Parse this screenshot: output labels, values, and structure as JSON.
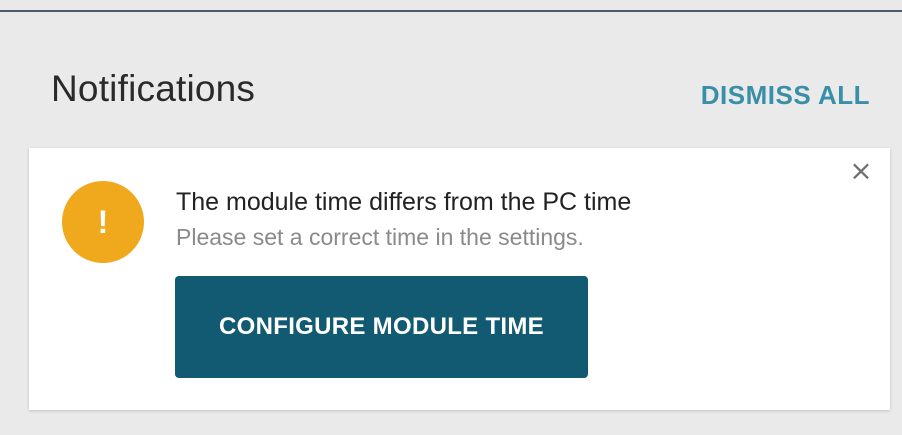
{
  "panel": {
    "title": "Notifications",
    "dismiss_all_label": "DISMISS ALL"
  },
  "notification": {
    "icon": "warning-exclamation-icon",
    "icon_glyph": "!",
    "close_glyph": "×",
    "title": "The module time differs from the PC time",
    "subtitle": "Please set a correct time in the settings.",
    "action_label": "CONFIGURE MODULE TIME"
  },
  "colors": {
    "accent_link": "#3a8fa8",
    "warning": "#f0a81d",
    "button_primary": "#125a72"
  }
}
